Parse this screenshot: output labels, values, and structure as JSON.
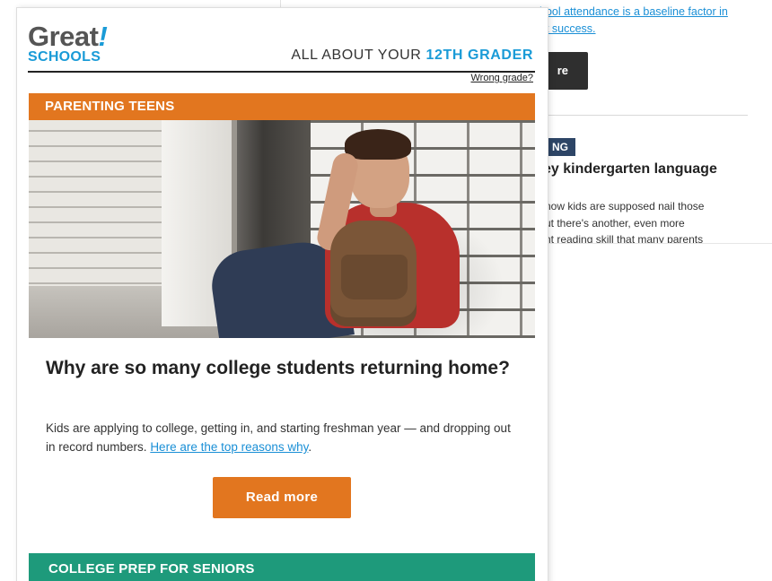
{
  "background_email": {
    "top_text_prefix": "",
    "top_link": "hool attendance is a baseline factor in",
    "top_link_line2": "nt success.",
    "read_more_fragment": "re",
    "tag_fragment": "NG",
    "headline_fragment": "ey kindergarten language",
    "body_lines": [
      "now kids are supposed nail those",
      "ut there's another, even more",
      "nt reading skill that many parents"
    ]
  },
  "header": {
    "logo_great": "Great",
    "logo_bang": "!",
    "logo_schools": "SCHOOLS",
    "grade_prefix": "ALL ABOUT YOUR",
    "grade_value": "12TH GRADER",
    "wrong_grade_link": "Wrong grade?"
  },
  "sections": {
    "parenting": "PARENTING TEENS",
    "college": "COLLEGE PREP FOR SENIORS"
  },
  "article": {
    "title": "Why are so many college students returning home?",
    "body": "Kids are applying to college, getting in, and starting freshman year — and dropping out in record numbers. ",
    "link": "Here are the top reasons why",
    "link_suffix": ".",
    "read_more_label": "Read more"
  },
  "colors": {
    "accent_orange": "#e2761f",
    "accent_blue": "#1a9bd7",
    "accent_green": "#1e9a7b",
    "tag_navy": "#2d4566"
  }
}
